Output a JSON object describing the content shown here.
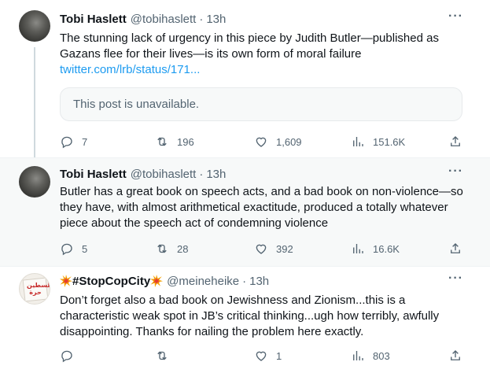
{
  "tweets": [
    {
      "name": "Tobi Haslett",
      "handle": "@tobihaslett",
      "dot": "·",
      "time": "13h",
      "text": "The stunning lack of urgency in this piece by Judith Butler—published as Gazans flee for their lives—is its own form of moral failure ",
      "link": "twitter.com/lrb/status/171...",
      "quote_unavailable": "This post is unavailable.",
      "replies": "7",
      "reposts": "196",
      "likes": "1,609",
      "views": "151.6K"
    },
    {
      "name": "Tobi Haslett",
      "handle": "@tobihaslett",
      "dot": "·",
      "time": "13h",
      "text": "Butler has a great book on speech acts, and a bad book on non-violence—so they have, with almost arithmetical exactitude, produced a totally whatever piece about the speech act of condemning violence",
      "replies": "5",
      "reposts": "28",
      "likes": "392",
      "views": "16.6K"
    },
    {
      "name": "#StopCopCity",
      "handle": "@meineheike",
      "dot": "·",
      "time": "13h",
      "text": "Don’t forget also a bad book on Jewishness and Zionism...this is a characteristic weak spot in JB’s critical thinking...ugh how terribly, awfully disappointing. Thanks for nailing the problem here exactly.",
      "replies": "",
      "reposts": "",
      "likes": "1",
      "views": "803",
      "avatar_text": "فلسطين حرة"
    }
  ],
  "more_label": "···",
  "colors": {
    "link": "#1d9bf0",
    "secondary_text": "#536471",
    "primary_text": "#0f1419",
    "highlight_bg": "#f7f9f9"
  },
  "icons": [
    "reply-icon",
    "repost-icon",
    "like-icon",
    "views-icon",
    "share-icon",
    "more-icon",
    "collision-emoji-icon"
  ]
}
